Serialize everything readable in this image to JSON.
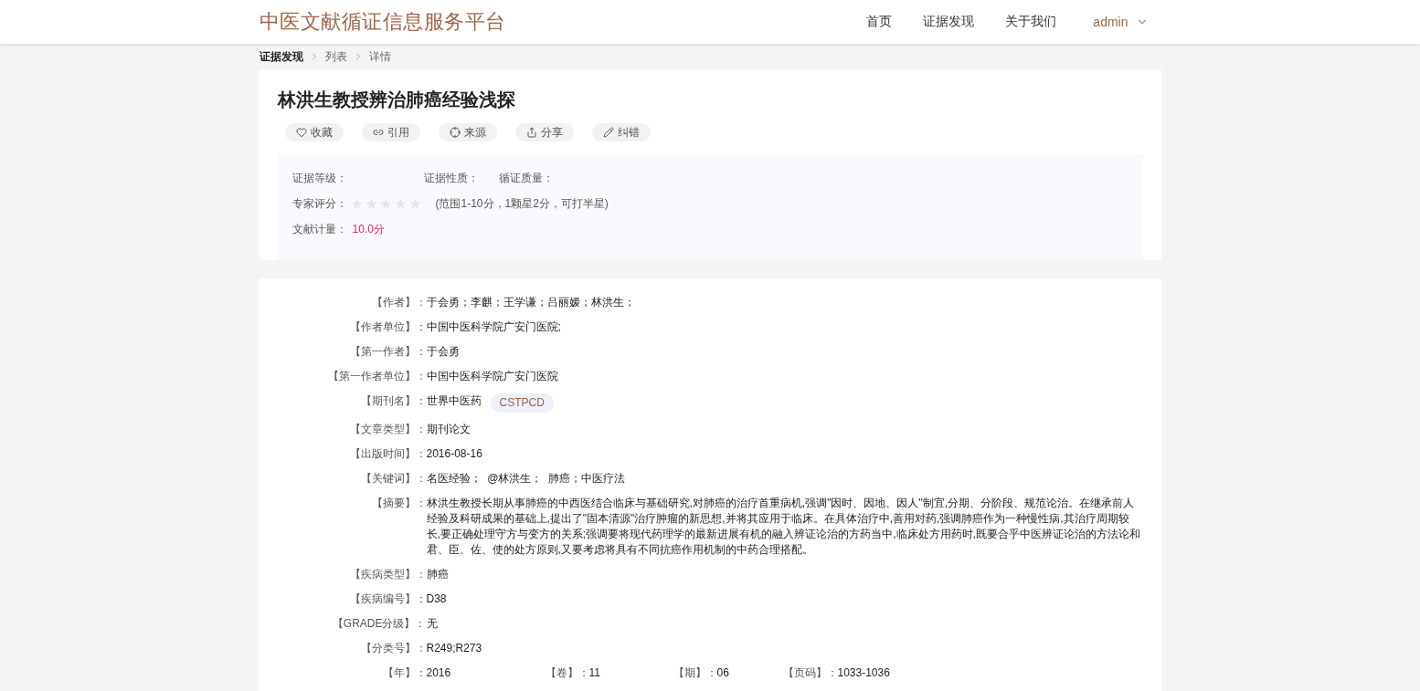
{
  "header": {
    "logo": "中医文献循证信息服务平台",
    "nav": [
      {
        "label": "首页",
        "selected": false
      },
      {
        "label": "证据发现",
        "selected": false
      },
      {
        "label": "关于我们",
        "selected": false
      }
    ],
    "user": "admin"
  },
  "breadcrumb": [
    "证据发现",
    "列表",
    "详情"
  ],
  "article": {
    "title": "林洪生教授辨治肺癌经验浅探",
    "actions": [
      {
        "kind": "heart",
        "label": "收藏"
      },
      {
        "kind": "link",
        "label": "引用"
      },
      {
        "kind": "target",
        "label": "来源"
      },
      {
        "kind": "share",
        "label": "分享"
      },
      {
        "kind": "edit",
        "label": "纠错"
      }
    ],
    "evidence": {
      "grade_label": "证据等级：",
      "nature_label": "证据性质：",
      "quality_label": "循证质量：",
      "rating_label": "专家评分：",
      "stars": 0,
      "rating_hint": "(范围1-10分，1颗星2分，可打半星)",
      "measure_label": "文献计量：",
      "measure_value": "10.0分"
    }
  },
  "details": [
    {
      "kind": "text",
      "label": "【作者】：",
      "value": "于会勇；李麒；王学谦；吕丽嫒；林洪生；"
    },
    {
      "kind": "text",
      "label": "【作者单位】：",
      "value": "中国中医科学院广安门医院;"
    },
    {
      "kind": "text",
      "label": "【第一作者】：",
      "value": "于会勇"
    },
    {
      "kind": "text",
      "label": "【第一作者单位】：",
      "value": "中国中医科学院广安门医院"
    },
    {
      "kind": "tagged",
      "label": "【期刊名】：",
      "value": "世界中医药",
      "tag": "CSTPCD"
    },
    {
      "kind": "text",
      "label": "【文章类型】：",
      "value": "期刊论文"
    },
    {
      "kind": "text",
      "label": "【出版时间】：",
      "value": "2016-08-16"
    },
    {
      "kind": "text",
      "label": "【关键词】：",
      "value": "名医经验；  @林洪生；  肺癌；中医疗法"
    },
    {
      "kind": "text",
      "label": "【摘要】：",
      "value": "林洪生教授长期从事肺癌的中西医结合临床与基础研究,对肺癌的治疗首重病机,强调\"因时、因地、因人\"制宜,分期、分阶段、规范论治。在继承前人经验及科研成果的基础上,提出了\"固本清源\"治疗肿瘤的新思想,并将其应用于临床。在具体治疗中,善用对药,强调肺癌作为一种慢性病,其治疗周期较长,要正确处理守方与变方的关系;强调要将现代药理学的最新进展有机的融入辨证论治的方药当中,临床处方用药时,既要合乎中医辨证论治的方法论和君、臣、佐、使的处方原则,又要考虑将具有不同抗癌作用机制的中药合理搭配。"
    },
    {
      "kind": "text",
      "label": "【疾病类型】：",
      "value": "肺癌"
    },
    {
      "kind": "text",
      "label": "【疾病编号】：",
      "value": "D38"
    },
    {
      "kind": "text",
      "label": "【GRADE分级】：",
      "value": "无"
    },
    {
      "kind": "text",
      "label": "【分类号】：",
      "value": "R249;R273"
    },
    {
      "kind": "pairs",
      "pairs": [
        {
          "label": "【年】：",
          "value": "2016"
        },
        {
          "label": "【卷】：",
          "value": "11"
        },
        {
          "label": "【期】：",
          "value": "06"
        },
        {
          "label": "【页码】：",
          "value": "1033-1036"
        }
      ]
    }
  ]
}
